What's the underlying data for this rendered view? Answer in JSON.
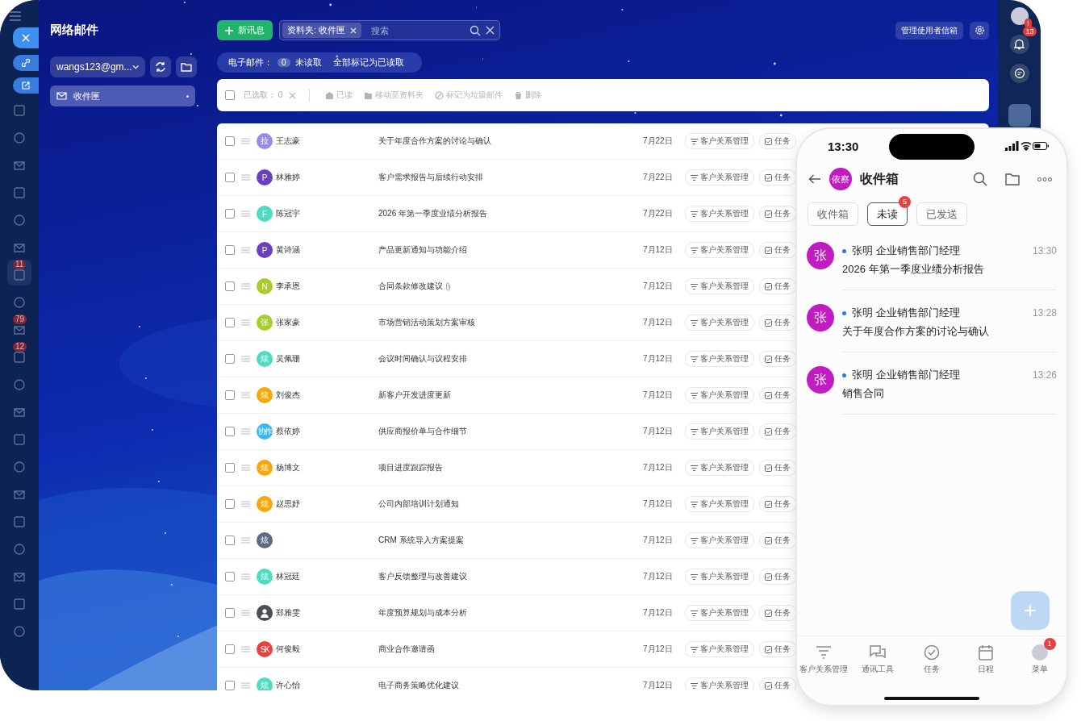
{
  "rail": {
    "items": [
      {
        "selected": false
      },
      {
        "selected": false
      },
      {
        "selected": false
      },
      {
        "selected": false
      },
      {
        "selected": false
      },
      {
        "selected": false
      },
      {
        "selected": true,
        "badge": "11"
      },
      {
        "selected": false
      },
      {
        "selected": false,
        "badge": "79"
      },
      {
        "selected": false,
        "badge": "12"
      },
      {
        "selected": false
      },
      {
        "selected": false
      },
      {
        "selected": false
      },
      {
        "selected": false
      },
      {
        "selected": false
      },
      {
        "selected": false
      },
      {
        "selected": false
      },
      {
        "selected": false
      },
      {
        "selected": false
      },
      {
        "selected": false
      }
    ]
  },
  "folders": {
    "title": "网络邮件",
    "account": "wangs123@gm...",
    "items": [
      {
        "label": "收件匣",
        "selected": true
      }
    ]
  },
  "toolbar": {
    "new_button": "新讯息",
    "search_chip": "资料夹: 收件匣",
    "search": {
      "placeholder": "搜索"
    },
    "manage_button": "管理使用者信箱"
  },
  "filter_bar": {
    "label": "电子邮件：",
    "count": "0",
    "unread": "未读取",
    "mark_all": "全部标记为已读取"
  },
  "action_bar": {
    "checked": false,
    "selected_label": "已选取：",
    "selected_count": "0",
    "actions": [
      {
        "kind": "read",
        "label": "已读",
        "disabled": true
      },
      {
        "kind": "move",
        "label": "移动至资料夹",
        "disabled": true
      },
      {
        "kind": "spam",
        "label": "标记为垃圾邮件",
        "disabled": true
      },
      {
        "kind": "delete",
        "label": "删除",
        "disabled": true
      }
    ]
  },
  "messages": [
    {
      "checked": false,
      "avatar": {
        "initials": "拉",
        "color": "#9a8ae8"
      },
      "name": "王志豪",
      "subject": "关于年度合作方案的讨论与确认",
      "date": "7月22日",
      "tags": [
        {
          "kind": "crm",
          "label": "客户关系管理"
        },
        {
          "kind": "task",
          "label": "任务"
        }
      ]
    },
    {
      "checked": false,
      "avatar": {
        "initials": "P",
        "color": "#6a3fc0"
      },
      "name": "林雅婷",
      "subject": "客户需求报告与后续行动安排",
      "date": "7月22日",
      "tags": [
        {
          "kind": "crm",
          "label": "客户关系管理"
        },
        {
          "kind": "task",
          "label": "任务"
        }
      ]
    },
    {
      "checked": false,
      "avatar": {
        "initials": "F",
        "color": "#4fdcc0"
      },
      "name": "陈冠宇",
      "subject": "2026 年第一季度业绩分析报告",
      "date": "7月22日",
      "tags": [
        {
          "kind": "crm",
          "label": "客户关系管理"
        },
        {
          "kind": "task",
          "label": "任务"
        }
      ]
    },
    {
      "checked": false,
      "avatar": {
        "initials": "P",
        "color": "#6a3fc0"
      },
      "name": "黄诗涵",
      "subject": "产品更新通知与功能介绍",
      "date": "7月12日",
      "tags": [
        {
          "kind": "crm",
          "label": "客户关系管理"
        },
        {
          "kind": "task",
          "label": "任务"
        }
      ]
    },
    {
      "checked": false,
      "avatar": {
        "initials": "N",
        "color": "#a9cc2c"
      },
      "name": "李承恩",
      "subject": "合同条款修改建议",
      "attachment": true,
      "date": "7月12日",
      "tags": [
        {
          "kind": "crm",
          "label": "客户关系管理"
        },
        {
          "kind": "task",
          "label": "任务"
        }
      ]
    },
    {
      "checked": false,
      "avatar": {
        "initials": "张",
        "color": "#a9cc2c"
      },
      "name": "张家豪",
      "subject": "市场营销活动策划方案审核",
      "date": "7月12日",
      "tags": [
        {
          "kind": "crm",
          "label": "客户关系管理"
        },
        {
          "kind": "task",
          "label": "任务"
        }
      ]
    },
    {
      "checked": false,
      "avatar": {
        "initials": "炫",
        "color": "#4fdcc0"
      },
      "name": "吴佩珊",
      "subject": "会议时间确认与议程安排",
      "date": "7月12日",
      "tags": [
        {
          "kind": "crm",
          "label": "客户关系管理"
        },
        {
          "kind": "task",
          "label": "任务"
        }
      ]
    },
    {
      "checked": false,
      "avatar": {
        "initials": "炫",
        "color": "#f5a70c"
      },
      "name": "刘俊杰",
      "subject": "新客户开发进度更新",
      "date": "7月12日",
      "tags": [
        {
          "kind": "crm",
          "label": "客户关系管理"
        },
        {
          "kind": "task",
          "label": "任务"
        }
      ]
    },
    {
      "checked": false,
      "avatar": {
        "initials": "协作",
        "color": "#3cb8f0"
      },
      "name": "蔡依婷",
      "subject": "供应商报价单与合作细节",
      "date": "7月12日",
      "tags": [
        {
          "kind": "crm",
          "label": "客户关系管理"
        },
        {
          "kind": "task",
          "label": "任务"
        }
      ]
    },
    {
      "checked": false,
      "avatar": {
        "initials": "炫",
        "color": "#f5a70c"
      },
      "name": "杨博文",
      "subject": "项目进度跟踪报告",
      "date": "7月12日",
      "tags": [
        {
          "kind": "crm",
          "label": "客户关系管理"
        },
        {
          "kind": "task",
          "label": "任务"
        }
      ]
    },
    {
      "checked": false,
      "avatar": {
        "initials": "炫",
        "color": "#f5a70c"
      },
      "name": "赵思妤",
      "subject": "公司内部培训计划通知",
      "date": "7月12日",
      "tags": [
        {
          "kind": "crm",
          "label": "客户关系管理"
        },
        {
          "kind": "task",
          "label": "任务"
        }
      ]
    },
    {
      "checked": false,
      "avatar": {
        "initials": "炫",
        "color": "#5b6b82"
      },
      "subject": "CRM 系统导入方案提案",
      "date": "7月12日",
      "tags": [
        {
          "kind": "crm",
          "label": "客户关系管理"
        },
        {
          "kind": "task",
          "label": "任务"
        }
      ]
    },
    {
      "checked": false,
      "avatar": {
        "initials": "炫",
        "color": "#4fdcc0"
      },
      "name": "林冠廷",
      "subject": "客户反馈整理与改善建议",
      "date": "7月12日",
      "tags": [
        {
          "kind": "crm",
          "label": "客户关系管理"
        },
        {
          "kind": "task",
          "label": "任务"
        }
      ]
    },
    {
      "checked": false,
      "avatar": {
        "kind": "person",
        "color": "#4a4f57"
      },
      "name": "郑雅雯",
      "subject": "年度预算规划与成本分析",
      "date": "7月12日",
      "tags": [
        {
          "kind": "crm",
          "label": "客户关系管理"
        },
        {
          "kind": "task",
          "label": "任务"
        }
      ]
    },
    {
      "checked": false,
      "avatar": {
        "initials": "SK",
        "color": "#e8403f"
      },
      "name": "何俊毅",
      "subject": "商业合作邀请函",
      "date": "7月12日",
      "tags": [
        {
          "kind": "crm",
          "label": "客户关系管理"
        },
        {
          "kind": "task",
          "label": "任务"
        }
      ]
    },
    {
      "checked": false,
      "avatar": {
        "initials": "炫",
        "color": "#4fdcc0"
      },
      "name": "许心怡",
      "subject": "电子商务策略优化建议",
      "date": "7月12日",
      "tags": [
        {
          "kind": "crm",
          "label": "客户关系管理"
        },
        {
          "kind": "task",
          "label": "任务"
        }
      ]
    }
  ],
  "right_strip": {
    "alert_badge": "!",
    "bell_badge": "13"
  },
  "phone": {
    "time": "13:30",
    "avatar": "依察",
    "title": "收件箱",
    "tabs": [
      {
        "label": "收件箱",
        "selected": false
      },
      {
        "label": "未读",
        "selected": true,
        "badge": "5"
      },
      {
        "label": "已发送",
        "selected": false
      }
    ],
    "messages": [
      {
        "avatar": "张",
        "sender": "张明 企业销售部门经理",
        "time": "13:30",
        "subject": "2026 年第一季度业绩分析报告",
        "unread": true
      },
      {
        "avatar": "张",
        "sender": "张明 企业销售部门经理",
        "time": "13:28",
        "subject": "关于年度合作方案的讨论与确认",
        "unread": true
      },
      {
        "avatar": "张",
        "sender": "张明 企业销售部门经理",
        "time": "13:26",
        "subject": "销售合同",
        "unread": true
      }
    ],
    "fab": "+",
    "nav": [
      {
        "kind": "crm",
        "label": "客户关系管理"
      },
      {
        "kind": "chat",
        "label": "通讯工具"
      },
      {
        "kind": "task",
        "label": "任务"
      },
      {
        "kind": "calendar",
        "label": "日程"
      },
      {
        "kind": "avatar",
        "label": "菜单",
        "badge": "1"
      }
    ]
  }
}
